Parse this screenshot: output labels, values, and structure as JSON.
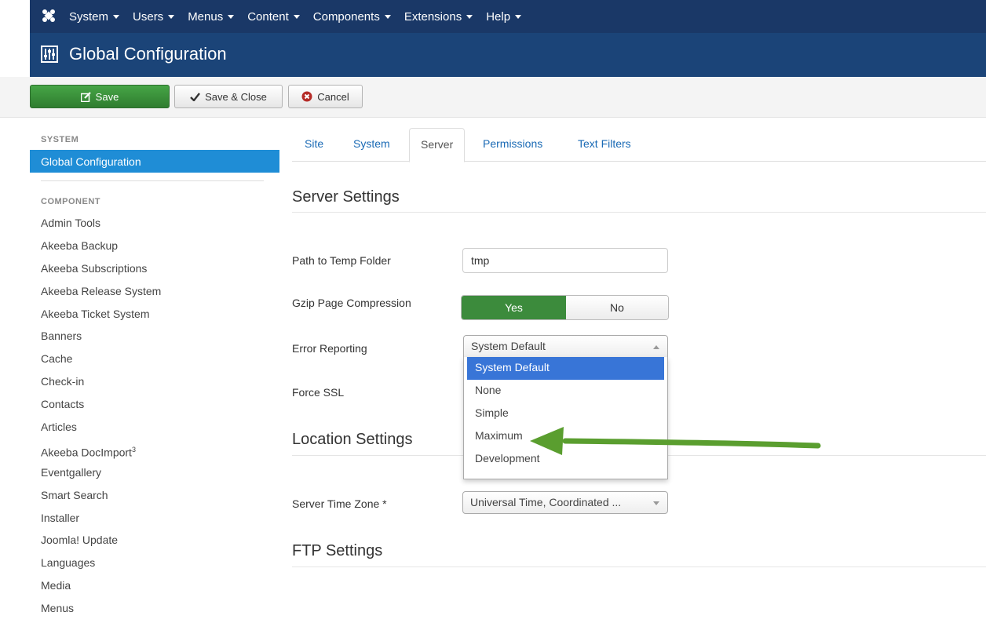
{
  "navbar": {
    "items": [
      {
        "label": "System"
      },
      {
        "label": "Users"
      },
      {
        "label": "Menus"
      },
      {
        "label": "Content"
      },
      {
        "label": "Components"
      },
      {
        "label": "Extensions"
      },
      {
        "label": "Help"
      }
    ]
  },
  "header": {
    "title": "Global Configuration"
  },
  "toolbar": {
    "save": "Save",
    "save_close": "Save & Close",
    "cancel": "Cancel"
  },
  "sidebar": {
    "system_heading": "SYSTEM",
    "active_item": "Global Configuration",
    "component_heading": "COMPONENT",
    "items": [
      "Admin Tools",
      "Akeeba Backup",
      "Akeeba Subscriptions",
      "Akeeba Release System",
      "Akeeba Ticket System",
      "Banners",
      "Cache",
      "Check-in",
      "Contacts",
      "Articles",
      "Akeeba DocImport",
      "Eventgallery",
      "Smart Search",
      "Installer",
      "Joomla! Update",
      "Languages",
      "Media",
      "Menus"
    ],
    "docimport_sup": "3"
  },
  "tabs": [
    "Site",
    "System",
    "Server",
    "Permissions",
    "Text Filters"
  ],
  "server": {
    "title": "Server Settings",
    "temp_label": "Path to Temp Folder",
    "temp_value": "tmp",
    "gzip_label": "Gzip Page Compression",
    "gzip_yes": "Yes",
    "gzip_no": "No",
    "error_label": "Error Reporting",
    "error_value": "System Default",
    "error_options": [
      "System Default",
      "None",
      "Simple",
      "Maximum",
      "Development"
    ],
    "ssl_label": "Force SSL"
  },
  "location": {
    "title": "Location Settings",
    "tz_label": "Server Time Zone *",
    "tz_value": "Universal Time, Coordinated ..."
  },
  "ftp": {
    "title": "FTP Settings"
  },
  "colors": {
    "navbar": "#1a3867",
    "titlebar": "#1b4478",
    "accent": "#1f8dd6",
    "save": "#3c8b3c",
    "arrow": "#5a9e2f"
  }
}
